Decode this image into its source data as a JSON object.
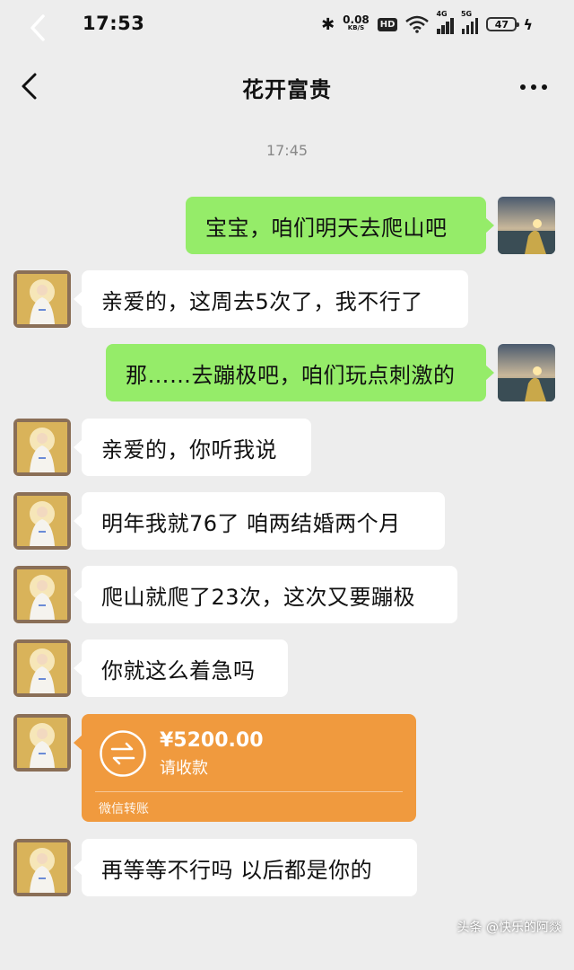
{
  "status_bar": {
    "time": "17:53",
    "bluetooth": "✱",
    "speed_value": "0.08",
    "speed_unit": "KB/S",
    "hd": "HD",
    "signal1": "4G",
    "signal2": "5G",
    "battery": "47",
    "icons": [
      "back-icon",
      "bluetooth-icon",
      "wifi-icon",
      "signal-icon",
      "battery-icon",
      "charging-icon"
    ]
  },
  "chat": {
    "title": "花开富贵",
    "timestamp": "17:45",
    "messages": [
      {
        "side": "out",
        "text": "宝宝，咱们明天去爬山吧"
      },
      {
        "side": "in",
        "text": "亲爱的，这周去5次了，我不行了"
      },
      {
        "side": "out",
        "text": "那……去蹦极吧，咱们玩点刺激的"
      },
      {
        "side": "in",
        "text": "亲爱的，你听我说"
      },
      {
        "side": "in",
        "text": "明年我就76了  咱两结婚两个月"
      },
      {
        "side": "in",
        "text": "爬山就爬了23次，这次又要蹦极"
      },
      {
        "side": "in",
        "text": "你就这么着急吗"
      },
      {
        "side": "in",
        "text": "再等等不行吗  以后都是你的"
      }
    ],
    "transfer": {
      "amount": "¥5200.00",
      "note": "请收款",
      "label": "微信转账"
    }
  },
  "watermark": "头条 @快乐的阿燚",
  "colors": {
    "background": "#ededed",
    "outgoing_bubble": "#95ec69",
    "incoming_bubble": "#ffffff",
    "transfer": "#f09a3e"
  }
}
